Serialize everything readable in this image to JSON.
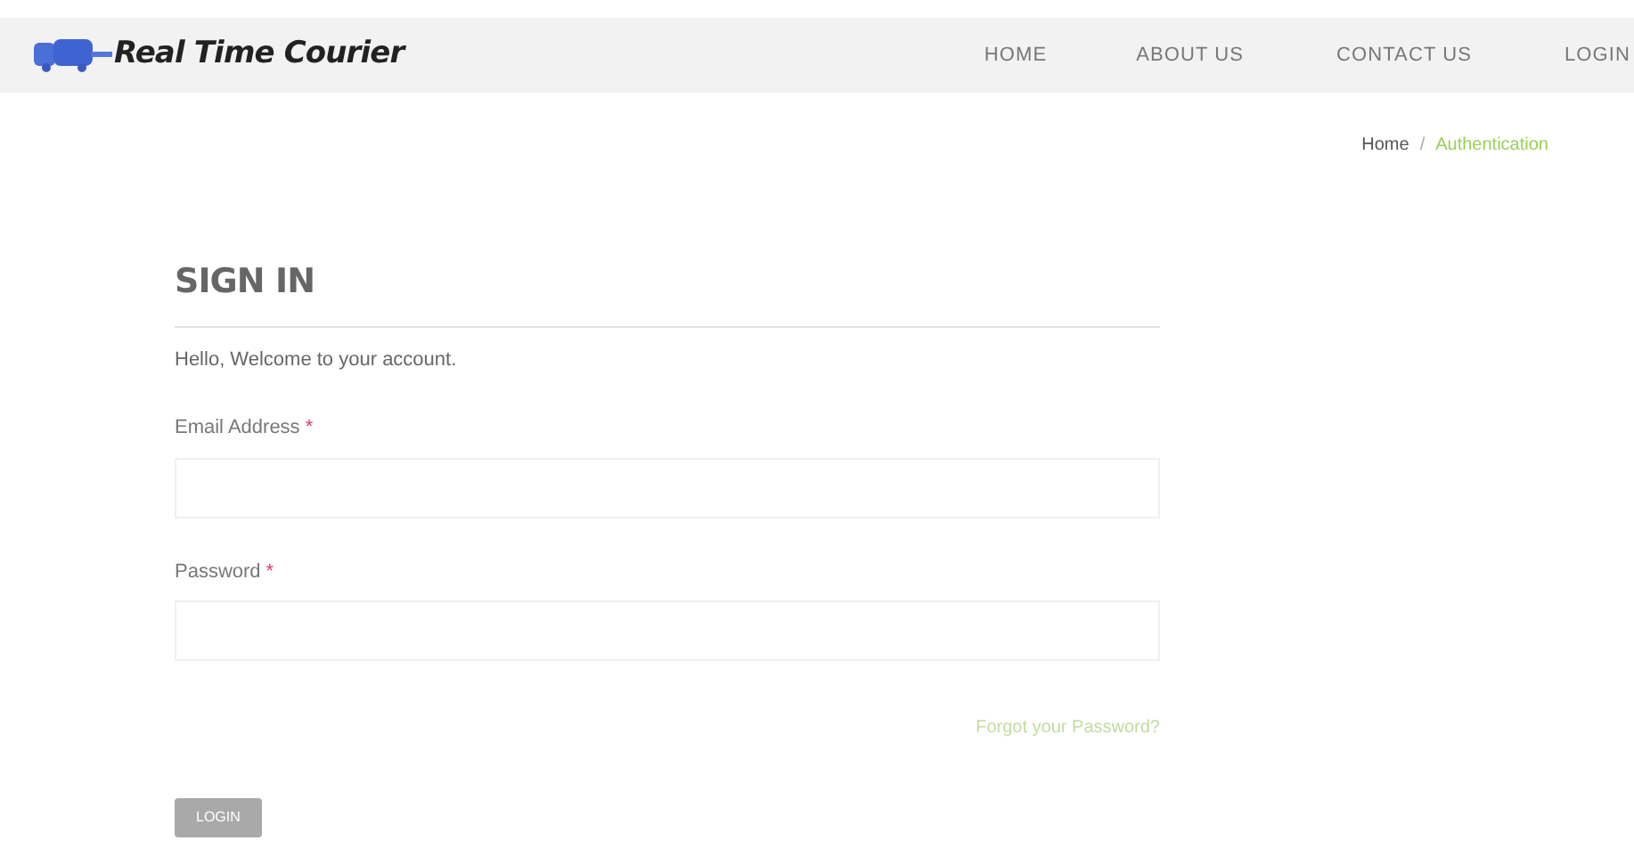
{
  "header": {
    "logo_text": "Real Time Courier",
    "nav": [
      {
        "label": "HOME"
      },
      {
        "label": "ABOUT US"
      },
      {
        "label": "CONTACT US"
      },
      {
        "label": "LOGIN"
      }
    ]
  },
  "breadcrumb": [
    {
      "label": "Home",
      "selected": false
    },
    {
      "label": "Authentication",
      "selected": true
    }
  ],
  "breadcrumb_separator": "/",
  "form": {
    "title": "SIGN IN",
    "welcome": "Hello, Welcome to your account.",
    "fields": [
      {
        "label": "Email Address",
        "required_mark": "*"
      },
      {
        "label": "Password",
        "required_mark": "*"
      }
    ],
    "forgot_link": "Forgot your Password?",
    "submit": "LOGIN"
  }
}
